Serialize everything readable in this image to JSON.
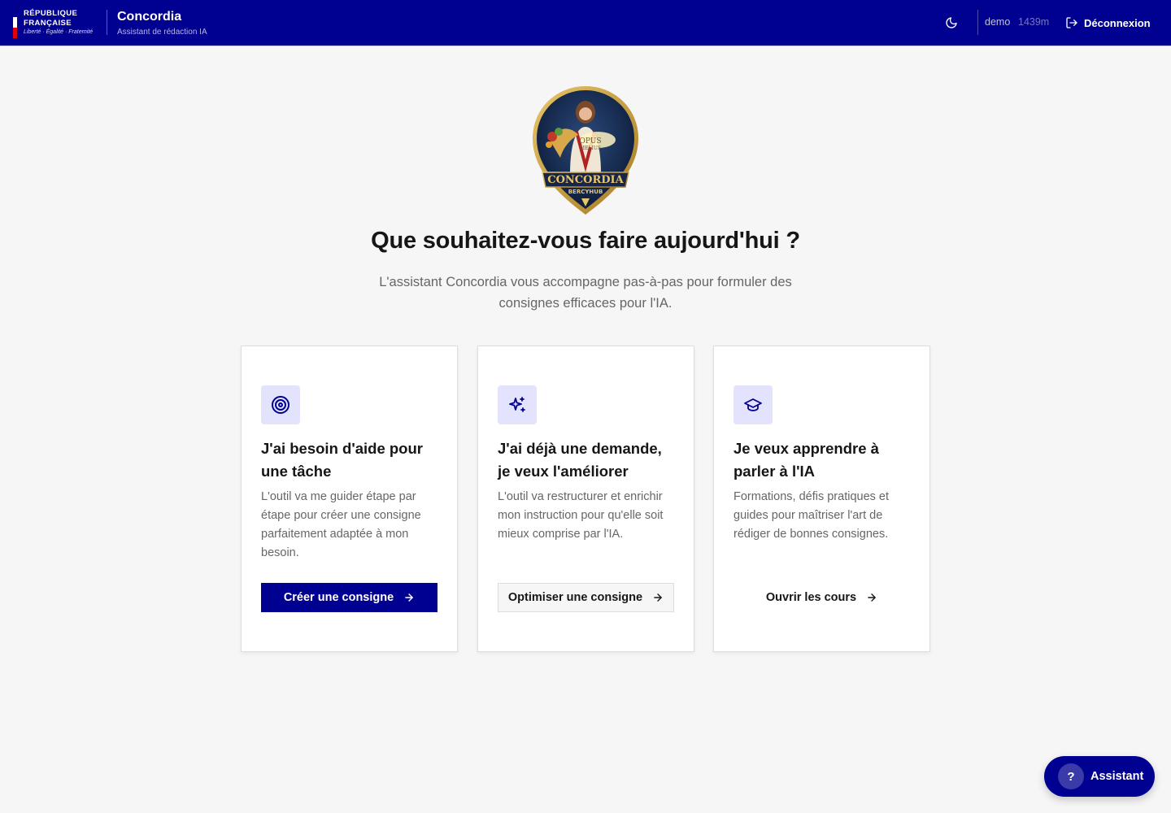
{
  "header": {
    "republic_line1": "RÉPUBLIQUE",
    "republic_line2": "FRANÇAISE",
    "motto": "Liberté · Égalité · Fraternité",
    "app_title": "Concordia",
    "app_subtitle": "Assistant de rédaction IA",
    "username": "demo",
    "session_timer": "1439m",
    "logout_label": "Déconnexion",
    "theme_icon": "moon-icon"
  },
  "emblem": {
    "motto_line1": "OPUS",
    "motto_line2": "MELIUS",
    "name": "CONCORDIA",
    "sub": "BERCYHUB"
  },
  "hero": {
    "title": "Que souhaitez-vous faire aujourd'hui ?",
    "subtitle": "L'assistant Concordia vous accompagne pas-à-pas pour formuler des consignes efficaces pour l'IA."
  },
  "cards": [
    {
      "icon": "target-icon",
      "title": "J'ai besoin d'aide pour une tâche",
      "description": "L'outil va me guider étape par étape pour créer une consigne parfaitement adaptée à mon besoin.",
      "button_label": "Créer une consigne"
    },
    {
      "icon": "sparkles-icon",
      "title": "J'ai déjà une demande, je veux l'améliorer",
      "description": "L'outil va restructurer et enrichir mon instruction pour qu'elle soit mieux comprise par l'IA.",
      "button_label": "Optimiser une consigne"
    },
    {
      "icon": "graduation-cap-icon",
      "title": "Je veux apprendre à parler à l'IA",
      "description": "Formations, défis pratiques et guides pour maîtriser l'art de rédiger de bonnes consignes.",
      "button_label": "Ouvrir les cours"
    }
  ],
  "assistant": {
    "icon_glyph": "?",
    "label": "Assistant"
  },
  "colors": {
    "primary": "#000091",
    "background": "#f6f6f6",
    "icon_bg": "#e3e3fd",
    "text": "#161616",
    "muted": "#666666",
    "flag_red": "#e1000f"
  }
}
